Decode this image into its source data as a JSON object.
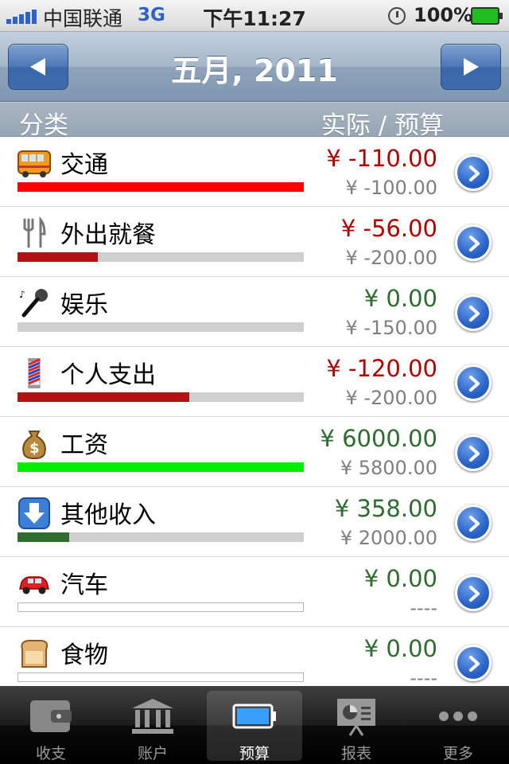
{
  "status_bar": {
    "carrier": "中国联通",
    "network": "3G",
    "time": "下午11:27",
    "battery": "100%"
  },
  "nav": {
    "title": "五月, 2011",
    "prev_icon": "left-arrow-icon",
    "next_icon": "right-arrow-icon"
  },
  "section_header": {
    "left": "分类",
    "right": "实际 / 预算"
  },
  "colors": {
    "over_budget": "#b10000",
    "ok": "#2f6d2f",
    "bar_red": "#ff0000",
    "bar_darkred": "#b01313",
    "bar_green": "#00ee00",
    "bar_darkgreen": "#2f6d2f"
  },
  "rows": [
    {
      "name": "交通",
      "icon": "bus-icon",
      "actual": "¥ -110.00",
      "budget": "¥ -100.00",
      "progress": 1.0,
      "bar_color": "#ff0000",
      "actual_color": "#b10000"
    },
    {
      "name": "外出就餐",
      "icon": "fork-knife-icon",
      "actual": "¥ -56.00",
      "budget": "¥ -200.00",
      "progress": 0.28,
      "bar_color": "#b01313",
      "actual_color": "#b10000"
    },
    {
      "name": "娱乐",
      "icon": "microphone-icon",
      "actual": "¥ 0.00",
      "budget": "¥ -150.00",
      "progress": 0.0,
      "bar_color": "#b01313",
      "actual_color": "#2f6d2f"
    },
    {
      "name": "个人支出",
      "icon": "barber-pole-icon",
      "actual": "¥ -120.00",
      "budget": "¥ -200.00",
      "progress": 0.6,
      "bar_color": "#b01313",
      "actual_color": "#b10000"
    },
    {
      "name": "工资",
      "icon": "money-bag-icon",
      "actual": "¥ 6000.00",
      "budget": "¥ 5800.00",
      "progress": 1.0,
      "bar_color": "#00ee00",
      "actual_color": "#2f6d2f"
    },
    {
      "name": "其他收入",
      "icon": "download-arrow-icon",
      "actual": "¥ 358.00",
      "budget": "¥ 2000.00",
      "progress": 0.18,
      "bar_color": "#2f6d2f",
      "actual_color": "#2f6d2f"
    },
    {
      "name": "汽车",
      "icon": "car-icon",
      "actual": "¥ 0.00",
      "budget": "----",
      "progress": 0.0,
      "bar_color": "#2f6d2f",
      "actual_color": "#2f6d2f",
      "no_budget": true
    },
    {
      "name": "食物",
      "icon": "bread-icon",
      "actual": "¥ 0.00",
      "budget": "----",
      "progress": 0.0,
      "bar_color": "#2f6d2f",
      "actual_color": "#2f6d2f",
      "no_budget": true
    }
  ],
  "tabs": [
    {
      "label": "收支",
      "icon": "wallet-icon",
      "active": false
    },
    {
      "label": "账户",
      "icon": "bank-icon",
      "active": false
    },
    {
      "label": "预算",
      "icon": "battery-icon",
      "active": true
    },
    {
      "label": "报表",
      "icon": "chart-board-icon",
      "active": false
    },
    {
      "label": "更多",
      "icon": "more-dots-icon",
      "active": false
    }
  ]
}
